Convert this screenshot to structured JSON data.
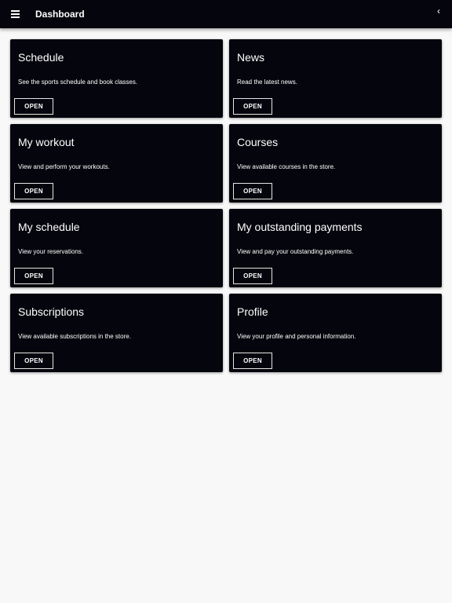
{
  "appbar": {
    "title": "Dashboard",
    "menu_icon": "hamburger-menu-icon",
    "back_icon": "chevron-left-icon",
    "back_glyph": "‹",
    "background": "#05050d"
  },
  "cards": [
    {
      "title": "Schedule",
      "description": "See the sports schedule and book classes.",
      "button": "OPEN"
    },
    {
      "title": "News",
      "description": "Read the latest news.",
      "button": "OPEN"
    },
    {
      "title": "My workout",
      "description": "View and perform your workouts.",
      "button": "OPEN"
    },
    {
      "title": "Courses",
      "description": "View available courses in the store.",
      "button": "OPEN"
    },
    {
      "title": "My schedule",
      "description": "View your reservations.",
      "button": "OPEN"
    },
    {
      "title": "My outstanding payments",
      "description": "View and pay your outstanding payments.",
      "button": "OPEN"
    },
    {
      "title": "Subscriptions",
      "description": "View available subscriptions in the store.",
      "button": "OPEN"
    },
    {
      "title": "Profile",
      "description": "View your profile and personal information.",
      "button": "OPEN"
    }
  ],
  "colors": {
    "card_background": "#05050d",
    "page_background": "#f8f8f9",
    "text": "#ffffff"
  }
}
